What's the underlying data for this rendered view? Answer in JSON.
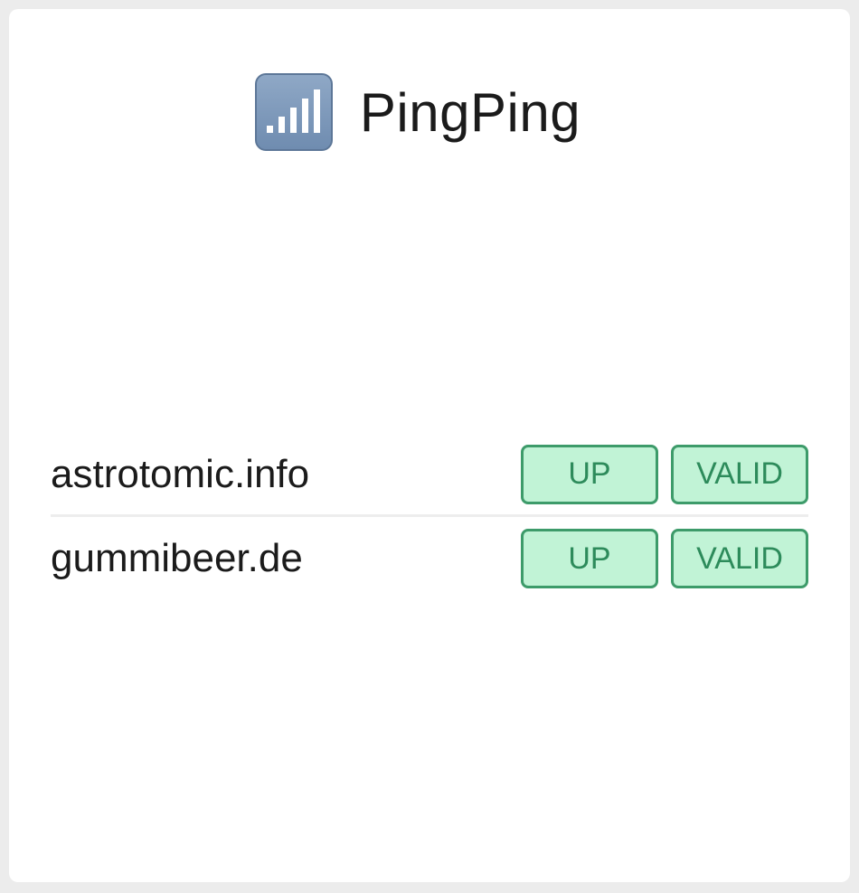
{
  "app": {
    "title": "PingPing",
    "icon": "signal-bars-icon",
    "icon_color": "#7b97bb"
  },
  "sites": [
    {
      "domain": "astrotomic.info",
      "uptime_status": "UP",
      "certificate_status": "VALID"
    },
    {
      "domain": "gummibeer.de",
      "uptime_status": "UP",
      "certificate_status": "VALID"
    }
  ],
  "colors": {
    "background": "#ececec",
    "card": "#ffffff",
    "badge_fill": "#c1f3d6",
    "badge_border": "#3d9b6a",
    "badge_text": "#2d8b5b"
  }
}
